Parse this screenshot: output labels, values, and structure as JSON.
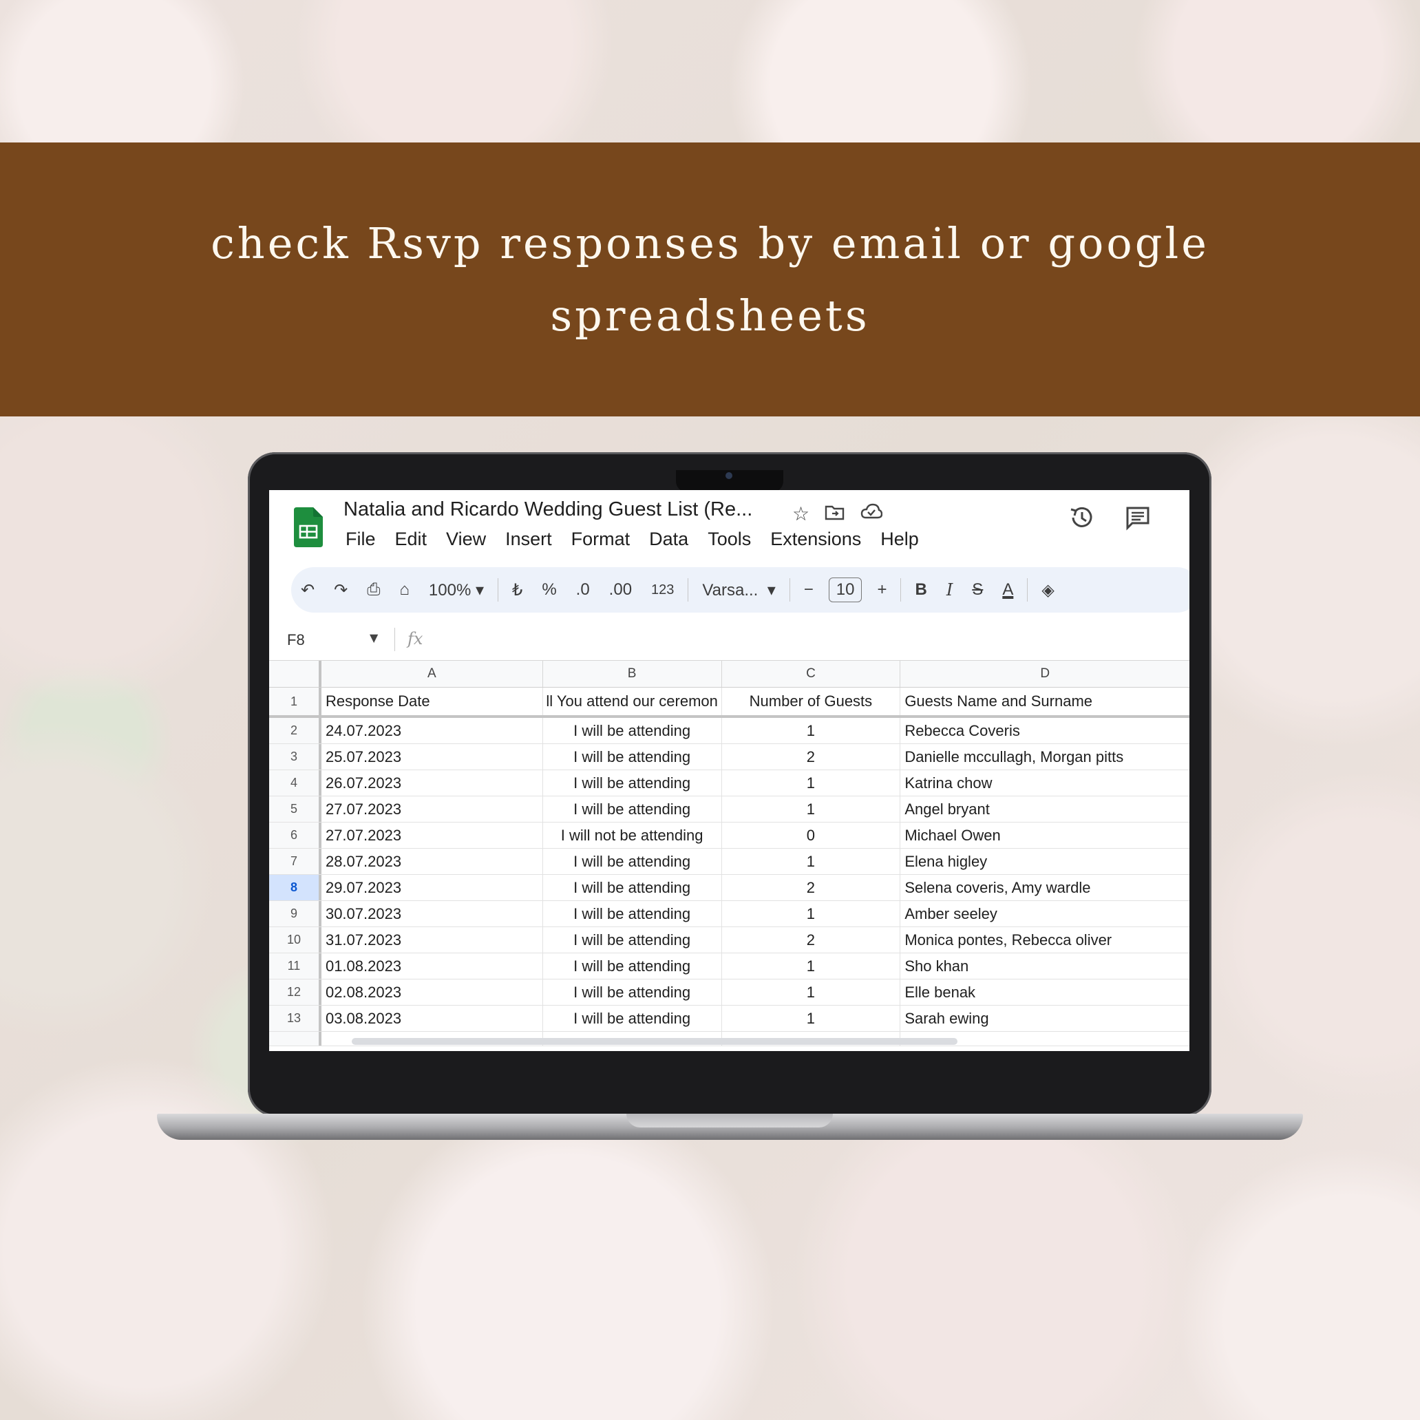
{
  "banner": {
    "line1": "check Rsvp responses by email or google",
    "line2": "spreadsheets"
  },
  "sheet": {
    "doc_title": "Natalia and Ricardo Wedding Guest List (Re...",
    "menu": [
      "File",
      "Edit",
      "View",
      "Insert",
      "Format",
      "Data",
      "Tools",
      "Extensions",
      "Help"
    ],
    "toolbar": {
      "zoom": "100%",
      "currency": "₺",
      "percent": "%",
      "decrease_decimal": ".0",
      "increase_decimal": ".00",
      "number_format": "123",
      "font": "Varsa...",
      "font_size": "10",
      "bold": "B",
      "italic": "I",
      "strike": "S",
      "text_color": "A"
    },
    "name_box": "F8",
    "fx": "fx",
    "columns": [
      "A",
      "B",
      "C",
      "D"
    ],
    "header_row": {
      "num": "1",
      "a": "Response Date",
      "b": "ll You attend our ceremon",
      "c": "Number of Guests",
      "d": "Guests Name and Surname"
    },
    "rows": [
      {
        "num": "2",
        "date": "24.07.2023",
        "attend": "I will be attending",
        "guests": "1",
        "names": "Rebecca Coveris"
      },
      {
        "num": "3",
        "date": "25.07.2023",
        "attend": "I will be attending",
        "guests": "2",
        "names": "Danielle mccullagh, Morgan pitts"
      },
      {
        "num": "4",
        "date": "26.07.2023",
        "attend": "I will be attending",
        "guests": "1",
        "names": "Katrina chow"
      },
      {
        "num": "5",
        "date": "27.07.2023",
        "attend": "I will be attending",
        "guests": "1",
        "names": "Angel bryant"
      },
      {
        "num": "6",
        "date": "27.07.2023",
        "attend": "I will not be attending",
        "guests": "0",
        "names": "Michael Owen"
      },
      {
        "num": "7",
        "date": "28.07.2023",
        "attend": "I will be attending",
        "guests": "1",
        "names": "Elena higley"
      },
      {
        "num": "8",
        "date": "29.07.2023",
        "attend": "I will be attending",
        "guests": "2",
        "names": "Selena coveris, Amy wardle"
      },
      {
        "num": "9",
        "date": "30.07.2023",
        "attend": "I will be attending",
        "guests": "1",
        "names": "Amber seeley"
      },
      {
        "num": "10",
        "date": "31.07.2023",
        "attend": "I will be attending",
        "guests": "2",
        "names": "Monica pontes, Rebecca oliver"
      },
      {
        "num": "11",
        "date": "01.08.2023",
        "attend": "I will be attending",
        "guests": "1",
        "names": "Sho khan"
      },
      {
        "num": "12",
        "date": "02.08.2023",
        "attend": "I will be attending",
        "guests": "1",
        "names": "Elle benak"
      },
      {
        "num": "13",
        "date": "03.08.2023",
        "attend": "I will be attending",
        "guests": "1",
        "names": "Sarah ewing"
      }
    ],
    "colors": {
      "banner": "#77471c",
      "sheets_green": "#1e8e3e",
      "toolbar_bg": "#edf2fa",
      "selected_row": "#d3e3fd"
    }
  }
}
